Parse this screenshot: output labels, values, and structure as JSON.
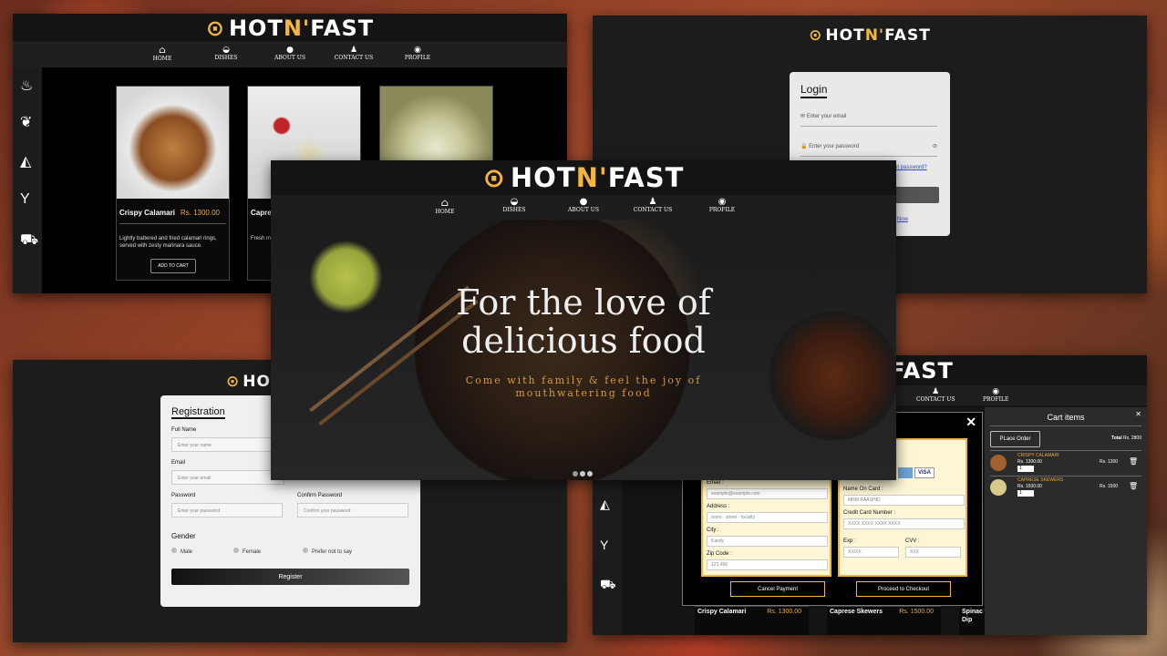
{
  "brand": {
    "name_a": "HOT ",
    "name_b": "N'",
    "name_c": "FAST"
  },
  "nav": [
    "HOME",
    "DISHES",
    "ABOUT US",
    "CONTACT US",
    "PROFILE"
  ],
  "menu": {
    "cards": [
      {
        "name": "Crispy Calamari",
        "price": "Rs. 1300.00",
        "desc": "Lightly battered and fried calamari rings, served with zesty marinara sauce.",
        "button": "ADD TO CART"
      },
      {
        "name": "Capres",
        "desc": "Fresh m basil dr"
      },
      {}
    ]
  },
  "login": {
    "title": "Login",
    "email_placeholder": "Enter your email",
    "password_placeholder": "Enter your password",
    "forgot": "ot password?",
    "signup": "Now"
  },
  "registration": {
    "title": "Registration",
    "full_name_label": "Full Name",
    "full_name_placeholder": "Enter your name",
    "email_label": "Email",
    "email_placeholder": "Enter your email",
    "password_label": "Password",
    "password_placeholder": "Enter your password",
    "confirm_label": "Confirm Password",
    "confirm_placeholder": "Confirm your password",
    "gender_label": "Gender",
    "genders": [
      "Male",
      "Female",
      "Prefer not to say"
    ],
    "button": "Register"
  },
  "hero": {
    "headline_1": "For the love of",
    "headline_2": "delicious food",
    "sub_1": "Come with family & feel the joy of",
    "sub_2": "mouthwatering food"
  },
  "cart": {
    "title": "Cart items",
    "place_order": "PLace Order",
    "total_label": "Total",
    "total_value": "Rs. 2800",
    "items": [
      {
        "name": "CRISPY CALAMARI",
        "unit": "Rs. 1300.00",
        "qty": "1",
        "sum": "Rs. 1300"
      },
      {
        "name": "CAPRESE SKEWERS",
        "unit": "Rs. 1500.00",
        "qty": "1",
        "sum": "Rs. 1500"
      }
    ]
  },
  "payment": {
    "email_label": "Email :",
    "email_value": "example@example.com",
    "address_label": "Address :",
    "address_value": "room - street - locality",
    "city_label": "City :",
    "city_value": "Kandy",
    "zip_label": "Zip Code :",
    "zip_value": "123 456",
    "name_label": "Name On Card :",
    "name_value": "MRM RAASHID",
    "cc_label": "Credit Card Number :",
    "cc_value": "XXXX XXXX XXXX XXXX",
    "exp_label": "Exp :",
    "exp_value": "XX/XX",
    "cvv_label": "CVV :",
    "cvv_value": "XXX",
    "cancel": "Cancel Payment",
    "proceed": "Proceed to Checkout",
    "visa": "VISA"
  },
  "bottom_cards": [
    {
      "name": "Crispy Calamari",
      "price": "Rs. 1300.00"
    },
    {
      "name": "Caprese Skewers",
      "price": "Rs. 1500.00"
    },
    {
      "name": "Spinac Dip"
    }
  ],
  "colors": {
    "accent": "#f0b640",
    "price": "#e3a94a",
    "hero_sub": "#d59a3c"
  }
}
